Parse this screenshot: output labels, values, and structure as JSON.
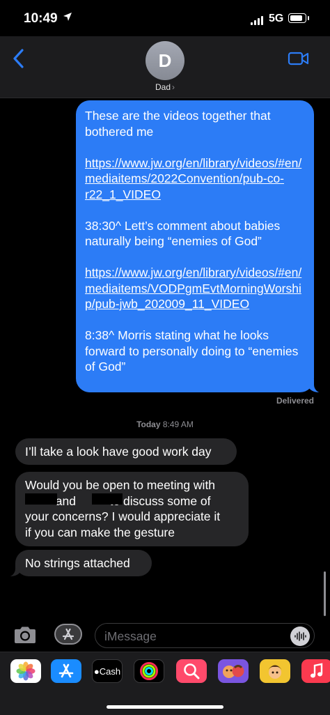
{
  "status_bar": {
    "time": "10:49",
    "network": "5G"
  },
  "header": {
    "avatar_initial": "D",
    "contact_name": "Dad",
    "contact_chevron": "›"
  },
  "messages": {
    "outgoing": {
      "part1": "These are the videos together that bothered me\n\n",
      "link1": "https://www.jw.org/en/library/videos/#en/mediaitems/2022Convention/pub-co-r22_1_VIDEO",
      "part2": "\n\n38:30^ Lett’s comment about babies naturally being “enemies of God”\n\n",
      "link2": "https://www.jw.org/en/library/videos/#en/mediaitems/VODPgmEvtMorningWorship/pub-jwb_202009_11_VIDEO",
      "part3": "\n\n8:38^ Morris stating what he looks forward to personally doing to “enemies of God”"
    },
    "delivered": "Delivered",
    "timestamp_day": "Today",
    "timestamp_time": "8:49 AM",
    "incoming": [
      "I’ll take a look have good work day",
      "Would you be open to meeting with\n         and          to discuss some of\nyour concerns? I would appreciate it\nif you can make the gesture",
      "No strings attached"
    ]
  },
  "compose": {
    "placeholder": "iMessage"
  },
  "app_drawer": [
    {
      "name": "photos",
      "color": "#ffffff"
    },
    {
      "name": "app-store",
      "color": "#1a8cff"
    },
    {
      "name": "apple-cash",
      "label": "Cash",
      "color": "#000000"
    },
    {
      "name": "activity",
      "color": "#000000"
    },
    {
      "name": "search-images",
      "color": "#ff4a6b"
    },
    {
      "name": "memoji",
      "color": "#7a55e0"
    },
    {
      "name": "memoji-stickers",
      "color": "#f2c530"
    },
    {
      "name": "music",
      "color": "#fa3a4f"
    }
  ],
  "colors": {
    "outgoing_bubble": "#2c7cf6",
    "incoming_bubble": "#262628",
    "accent": "#2c7cf6"
  }
}
